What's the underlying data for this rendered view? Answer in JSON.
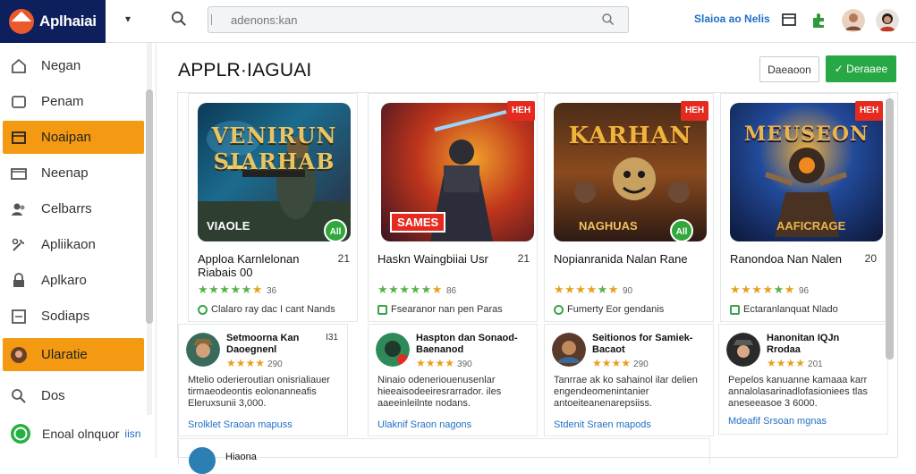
{
  "brand": {
    "name": "Aplhaiai",
    "caret": "▾"
  },
  "search": {
    "placeholder": "adenons:kan"
  },
  "header": {
    "link": "Slaioa ao Nelis"
  },
  "sidebar": {
    "items": [
      {
        "label": "Negan",
        "icon": "home-icon"
      },
      {
        "label": "Penam",
        "icon": "document-icon"
      },
      {
        "label": "Noaipan",
        "icon": "folder-icon",
        "active": true
      },
      {
        "label": "Neenap",
        "icon": "inbox-icon"
      },
      {
        "label": "Celbarrs",
        "icon": "users-icon"
      },
      {
        "label": "Apliikaon",
        "icon": "tools-icon"
      },
      {
        "label": "Aplkaro",
        "icon": "lock-icon"
      },
      {
        "label": "Sodiaps",
        "icon": "list-icon"
      },
      {
        "label": "Ularatie",
        "icon": "user-avatar-icon",
        "active": true
      },
      {
        "label": "Dos",
        "icon": "search-icon"
      },
      {
        "label": "Enoal olnquor",
        "suffix": "iisn",
        "icon": "whatsapp-icon"
      }
    ]
  },
  "main": {
    "title": "APPLR·IAGUAI",
    "secondary_button": "Daeaoon",
    "primary_button": "✓ Deraaee"
  },
  "cards": [
    {
      "art_title": "VENIRUN SIARHAB",
      "art_sub": "VIAOLE",
      "badge": "All",
      "tag": "",
      "name": "Apploa Karnlelonan Riabais 00",
      "rank": "21",
      "stars": 5,
      "gold_stars": 1,
      "count": "36",
      "meta": "Clalaro ray dac I cant Nands",
      "review": {
        "name": "Setmoorna Kan Daoegnenl",
        "date": "I31",
        "stars": 3,
        "count": "290",
        "text": "Mtelio oderieroutian onisrialiauer tirmaeodeontis eolonanneafis Eleruxsunii  3,000.",
        "link": "Srolklet Sraoan mapuss"
      }
    },
    {
      "art_title": "",
      "art_sub": "SAMES",
      "badge": "",
      "tag": "HEH",
      "name": "Haskn Waingbiiai Usr",
      "rank": "21",
      "stars": 5,
      "gold_stars": 1,
      "count": "86",
      "meta": "Fsearanor nan pen Paras",
      "review": {
        "name": "Haspton dan Sonaod- Baenanod",
        "date": "",
        "stars": 4,
        "count": "390",
        "text": "Ninaio odeneriouenusenlar hieeaisodeeiresrarrador. iles aaeeinleilnte nodans.",
        "link": "Ulaknif Sraon nagons"
      }
    },
    {
      "art_title": "KARHAN",
      "art_sub": "NAGHUAS",
      "badge": "All",
      "tag": "HEH",
      "name": "Nopianranida Nalan Rane",
      "rank": "",
      "stars": 4,
      "gold_stars": 1,
      "count": "90",
      "meta": "Fumerty Eor gendanis",
      "review": {
        "name": "Seitionos for Samiek- Bacaot",
        "date": "",
        "stars": 4,
        "count": "290",
        "text": "Tanrrae ak ko sahainol ilar delien engendeomenintanier antoeiteanenarepsiiss.",
        "link": "Stdenit Sraen mapods"
      }
    },
    {
      "art_title": "MEUSEON",
      "art_sub": "AAFICRAGE",
      "badge": "",
      "tag": "HEH",
      "name": "Ranondoa Nan Nalen",
      "rank": "20",
      "stars": 4,
      "gold_stars": 1,
      "count": "96",
      "meta": "Ectaranlanquat Nlado",
      "review": {
        "name": "Hanonitan IQJn Rrodaa",
        "date": "",
        "stars": 4,
        "count": "201",
        "text": "Pepelos kanuanne kamaaa karr annalolasarinadlofasioniees tlas aneseeasoe 3 6000.",
        "link": "Mdeafif Srsoan mgnas"
      }
    }
  ],
  "peek": {
    "name": "Hiaona"
  },
  "colors": {
    "accent": "#f39a12",
    "brand": "#0d1f5c",
    "primary": "#28a745",
    "link": "#1f6fc5"
  }
}
